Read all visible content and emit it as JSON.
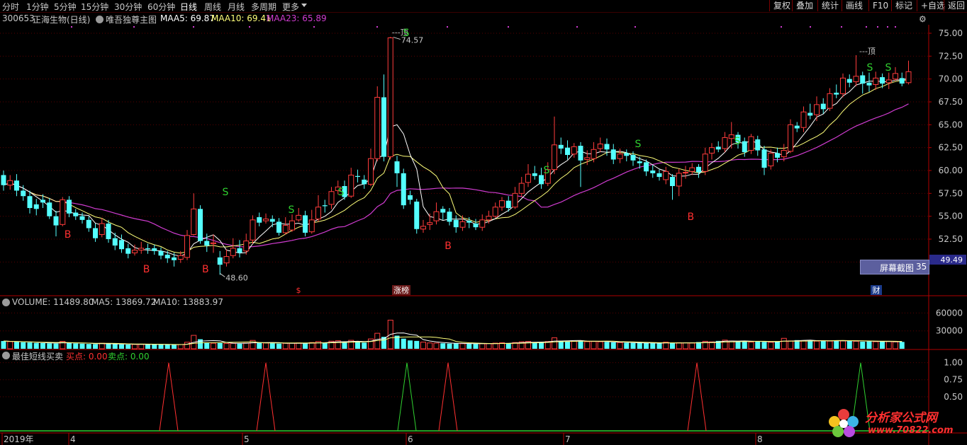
{
  "toolbar": {
    "periods": [
      "分时",
      "1分钟",
      "5分钟",
      "15分钟",
      "30分钟",
      "60分钟",
      "日线",
      "周线",
      "月线",
      "多周期",
      "更多"
    ],
    "active_period": "日线",
    "right_buttons": [
      "复权",
      "叠加",
      "统计",
      "画线",
      "F10",
      "标记",
      "+自选",
      "返回"
    ]
  },
  "stock": {
    "code": "300653",
    "name": "正海生物(日线)",
    "indicator": "唯吾独尊主图",
    "maa5_label": "MAA5: 69.87",
    "maa10_label": "MAA10: 69.41",
    "maa23_label": "MAA23: 65.89"
  },
  "colors": {
    "up": "#ff3c3c",
    "down": "#54ffff",
    "ma5": "#ffffff",
    "ma10": "#ffff7a",
    "ma23": "#d03cd0",
    "buy": "#ff3030",
    "sell": "#30d030",
    "axis": "#b00000",
    "grid": "#5a0000"
  },
  "chart_data": {
    "type": "candlestick",
    "title": "300653 正海生物(日线)",
    "y_ticks": [
      "75.00",
      "72.50",
      "70.00",
      "67.50",
      "65.00",
      "62.50",
      "60.00",
      "57.50",
      "55.00",
      "52.50"
    ],
    "ylim": [
      48.0,
      76.0
    ],
    "x_ticks": [
      "2019年",
      "4",
      "5",
      "6",
      "7",
      "8"
    ],
    "high_label": "74.57",
    "low_label": "48.60",
    "peak_label": "---顶",
    "peak_label_2": "---顶",
    "crosshair_price": "49.49",
    "candles": [
      [
        59.5,
        58.4,
        60.0,
        57.8
      ],
      [
        58.4,
        58.9,
        59.5,
        57.9
      ],
      [
        58.9,
        57.8,
        59.6,
        57.2
      ],
      [
        57.8,
        57.2,
        58.4,
        56.7
      ],
      [
        57.2,
        55.9,
        57.8,
        55.3
      ],
      [
        56.3,
        55.8,
        56.9,
        55.1
      ],
      [
        56.8,
        56.5,
        57.4,
        55.9
      ],
      [
        56.5,
        55.0,
        57.0,
        54.7
      ],
      [
        55.0,
        54.0,
        55.6,
        52.8
      ],
      [
        54.1,
        56.8,
        57.1,
        53.9
      ],
      [
        56.8,
        55.3,
        57.2,
        54.9
      ],
      [
        55.4,
        55.0,
        55.8,
        54.6
      ],
      [
        55.0,
        54.6,
        55.4,
        54.2
      ],
      [
        54.6,
        53.7,
        55.0,
        53.3
      ],
      [
        53.7,
        52.6,
        54.2,
        52.2
      ],
      [
        53.0,
        54.2,
        54.8,
        52.7
      ],
      [
        54.2,
        52.5,
        54.6,
        52.1
      ],
      [
        52.6,
        51.8,
        53.2,
        51.3
      ],
      [
        52.4,
        51.4,
        53.0,
        51.0
      ],
      [
        51.5,
        50.9,
        52.0,
        50.4
      ],
      [
        51.0,
        51.3,
        51.9,
        50.7
      ],
      [
        51.3,
        51.5,
        52.2,
        50.9
      ],
      [
        51.5,
        51.4,
        52.0,
        50.9
      ],
      [
        51.5,
        51.2,
        51.9,
        50.8
      ],
      [
        51.2,
        50.7,
        51.6,
        50.3
      ],
      [
        50.8,
        50.4,
        51.2,
        49.9
      ],
      [
        50.5,
        50.2,
        51.0,
        49.5
      ],
      [
        50.3,
        50.7,
        51.2,
        49.9
      ],
      [
        50.5,
        52.9,
        53.5,
        50.2
      ],
      [
        53.0,
        55.8,
        57.5,
        52.9
      ],
      [
        55.8,
        52.3,
        56.2,
        52.0
      ],
      [
        52.3,
        51.8,
        53.1,
        51.1
      ],
      [
        52.0,
        52.1,
        53.0,
        51.0
      ],
      [
        50.5,
        49.7,
        51.2,
        48.6
      ],
      [
        49.9,
        50.6,
        51.4,
        49.5
      ],
      [
        50.7,
        51.5,
        52.6,
        50.4
      ],
      [
        51.5,
        51.0,
        52.4,
        50.5
      ],
      [
        51.2,
        52.3,
        53.1,
        50.8
      ],
      [
        52.4,
        54.6,
        55.1,
        52.0
      ],
      [
        54.9,
        54.3,
        55.4,
        53.9
      ],
      [
        54.5,
        54.7,
        55.3,
        54.2
      ],
      [
        54.7,
        54.4,
        55.1,
        53.8
      ],
      [
        54.4,
        53.2,
        54.8,
        52.9
      ],
      [
        53.2,
        54.0,
        54.9,
        53.0
      ],
      [
        53.5,
        54.5,
        55.2,
        53.3
      ],
      [
        54.6,
        55.1,
        55.9,
        54.4
      ],
      [
        55.1,
        53.2,
        55.6,
        52.8
      ],
      [
        53.3,
        54.6,
        55.7,
        53.1
      ],
      [
        54.7,
        56.0,
        57.3,
        54.4
      ],
      [
        56.2,
        56.1,
        56.8,
        55.4
      ],
      [
        56.3,
        57.7,
        58.2,
        55.8
      ],
      [
        57.8,
        58.2,
        58.9,
        57.4
      ],
      [
        58.3,
        57.1,
        58.9,
        56.8
      ],
      [
        57.2,
        59.5,
        60.3,
        57.0
      ],
      [
        59.4,
        59.3,
        60.1,
        58.7
      ],
      [
        59.0,
        58.5,
        59.5,
        58.0
      ],
      [
        58.5,
        61.3,
        62.4,
        58.3
      ],
      [
        61.3,
        68.0,
        69.2,
        61.0
      ],
      [
        68.0,
        61.5,
        70.5,
        61.0
      ],
      [
        61.5,
        74.5,
        74.6,
        61.2
      ],
      [
        61.0,
        59.7,
        61.6,
        58.2
      ],
      [
        59.7,
        56.2,
        60.2,
        55.8
      ],
      [
        57.3,
        56.8,
        57.8,
        56.3
      ],
      [
        56.6,
        53.6,
        56.9,
        53.1
      ],
      [
        53.6,
        53.9,
        54.6,
        53.2
      ],
      [
        54.1,
        54.3,
        55.3,
        53.5
      ],
      [
        54.5,
        55.5,
        56.5,
        54.1
      ],
      [
        55.8,
        55.4,
        56.1,
        54.6
      ],
      [
        55.5,
        54.4,
        55.9,
        54.0
      ],
      [
        54.6,
        53.8,
        55.1,
        53.2
      ],
      [
        53.8,
        54.4,
        55.1,
        53.4
      ],
      [
        54.5,
        54.3,
        54.9,
        53.7
      ],
      [
        54.2,
        53.8,
        54.7,
        53.5
      ],
      [
        53.8,
        54.6,
        55.2,
        53.4
      ],
      [
        54.6,
        55.0,
        55.6,
        54.2
      ],
      [
        55.0,
        56.0,
        56.5,
        54.8
      ],
      [
        56.0,
        56.7,
        57.1,
        55.6
      ],
      [
        56.7,
        55.9,
        57.2,
        55.5
      ],
      [
        56.0,
        57.5,
        58.2,
        55.8
      ],
      [
        57.5,
        58.6,
        59.3,
        57.1
      ],
      [
        58.7,
        59.6,
        60.7,
        58.2
      ],
      [
        59.7,
        59.4,
        60.5,
        59.0
      ],
      [
        59.5,
        58.5,
        60.3,
        58.0
      ],
      [
        58.6,
        60.1,
        60.9,
        58.3
      ],
      [
        60.1,
        62.8,
        65.9,
        59.6
      ],
      [
        62.8,
        62.4,
        63.6,
        61.8
      ],
      [
        62.5,
        61.7,
        63.3,
        61.2
      ],
      [
        61.8,
        62.6,
        63.0,
        61.4
      ],
      [
        62.7,
        61.1,
        63.1,
        58.2
      ],
      [
        61.2,
        61.4,
        62.2,
        60.6
      ],
      [
        61.3,
        62.3,
        63.1,
        60.9
      ],
      [
        62.4,
        62.9,
        63.6,
        62.0
      ],
      [
        62.9,
        62.3,
        63.5,
        61.6
      ],
      [
        62.3,
        61.2,
        62.9,
        60.7
      ],
      [
        61.3,
        61.8,
        62.4,
        60.8
      ],
      [
        61.9,
        61.6,
        62.3,
        61.0
      ],
      [
        61.7,
        61.1,
        62.1,
        60.5
      ],
      [
        61.0,
        60.8,
        61.5,
        60.2
      ],
      [
        60.9,
        59.9,
        61.2,
        59.4
      ],
      [
        60.0,
        59.7,
        60.6,
        59.2
      ],
      [
        59.7,
        59.3,
        60.1,
        58.9
      ],
      [
        59.0,
        59.9,
        60.4,
        58.5
      ],
      [
        59.3,
        58.3,
        59.6,
        56.8
      ],
      [
        58.3,
        59.7,
        60.2,
        57.2
      ],
      [
        59.8,
        59.8,
        60.5,
        59.1
      ],
      [
        59.9,
        60.3,
        60.8,
        59.5
      ],
      [
        60.4,
        59.8,
        60.7,
        59.2
      ],
      [
        59.9,
        61.8,
        62.5,
        59.5
      ],
      [
        61.9,
        62.5,
        63.0,
        61.2
      ],
      [
        62.6,
        62.3,
        63.2,
        62.0
      ],
      [
        62.4,
        63.6,
        64.2,
        62.0
      ],
      [
        63.5,
        63.9,
        65.3,
        62.4
      ],
      [
        63.9,
        63.1,
        64.2,
        62.4
      ],
      [
        63.2,
        62.0,
        63.6,
        61.5
      ],
      [
        62.2,
        63.7,
        64.0,
        61.8
      ],
      [
        63.4,
        62.2,
        63.8,
        61.6
      ],
      [
        62.3,
        60.3,
        62.7,
        59.5
      ],
      [
        60.5,
        61.9,
        62.3,
        60.1
      ],
      [
        61.9,
        61.4,
        62.5,
        60.9
      ],
      [
        61.5,
        62.2,
        62.9,
        61.0
      ],
      [
        62.1,
        65.0,
        65.6,
        61.9
      ],
      [
        64.9,
        64.6,
        65.3,
        64.2
      ],
      [
        64.7,
        66.4,
        67.0,
        64.2
      ],
      [
        66.3,
        66.0,
        67.3,
        65.6
      ],
      [
        66.1,
        67.2,
        68.1,
        65.4
      ],
      [
        67.3,
        66.7,
        67.9,
        66.2
      ],
      [
        66.8,
        68.4,
        69.0,
        66.5
      ],
      [
        68.5,
        68.3,
        69.4,
        67.9
      ],
      [
        68.4,
        70.1,
        70.6,
        68.0
      ],
      [
        70.0,
        69.6,
        70.5,
        69.1
      ],
      [
        69.7,
        70.3,
        72.6,
        69.2
      ],
      [
        70.4,
        69.5,
        70.8,
        68.4
      ],
      [
        69.6,
        69.3,
        70.7,
        68.6
      ],
      [
        69.4,
        70.1,
        70.8,
        68.8
      ],
      [
        70.2,
        69.5,
        70.6,
        69.0
      ],
      [
        69.6,
        69.9,
        70.7,
        68.9
      ],
      [
        70.0,
        70.6,
        71.3,
        69.8
      ],
      [
        70.1,
        69.5,
        70.7,
        69.2
      ],
      [
        69.6,
        70.8,
        72.0,
        69.4
      ]
    ],
    "buy_points": [
      "B",
      "B",
      "B",
      "B",
      "B",
      "B"
    ],
    "sell_points": [
      "S",
      "S",
      "S",
      "S",
      "S",
      "S",
      "S",
      "S",
      "S"
    ],
    "markers_bottom": [
      "$",
      "涨榜",
      "财"
    ]
  },
  "volume_panel": {
    "title": "VOLUME: 11489.80",
    "ma5": "MA5: 13869.72",
    "ma10": "MA10: 13883.97",
    "y_ticks": [
      "60000",
      "30000"
    ],
    "volumes": [
      13000,
      12000,
      11500,
      11000,
      10500,
      9800,
      9500,
      9200,
      8800,
      12500,
      9600,
      8900,
      8500,
      8100,
      7900,
      9300,
      8300,
      7700,
      7400,
      7100,
      7300,
      7600,
      7500,
      7200,
      6900,
      6800,
      6700,
      7200,
      11000,
      22500,
      16000,
      9800,
      9300,
      9700,
      8800,
      9100,
      8600,
      9500,
      14000,
      10200,
      9800,
      9300,
      8700,
      9100,
      9400,
      9800,
      8800,
      10500,
      12200,
      10000,
      12800,
      13500,
      10800,
      14200,
      11500,
      10400,
      16500,
      26000,
      20000,
      48000,
      22000,
      17000,
      14000,
      13200,
      11200,
      9800,
      9500,
      9200,
      8700,
      8900,
      8500,
      8400,
      8200,
      8600,
      8800,
      9500,
      10200,
      9300,
      10500,
      11800,
      12400,
      11200,
      10400,
      12200,
      18500,
      13200,
      12100,
      12600,
      13800,
      11900,
      12200,
      11800,
      11500,
      10800,
      10400,
      10100,
      9800,
      9500,
      9700,
      9300,
      9100,
      11200,
      9400,
      10200,
      10100,
      9600,
      11300,
      12600,
      11600,
      13200,
      14500,
      13100,
      12100,
      12700,
      11300,
      12900,
      11500,
      10900,
      11600,
      17500,
      13200,
      14500,
      13600,
      14100,
      12800,
      13400,
      12900,
      14300,
      13200,
      14100,
      12600,
      11900,
      12300,
      11800,
      12100,
      12300,
      11500,
      11489.8
    ],
    "ylim": [
      0,
      70000
    ]
  },
  "indicator_panel": {
    "title": "最佳短线买卖",
    "buy_label": "买点: 0.00",
    "sell_label": "卖点: 0.00",
    "y_ticks": [
      "1.00",
      "0.75",
      "0.50"
    ],
    "ylim": [
      0,
      1.1
    ]
  },
  "screenshot_button": {
    "label": "屏幕截图",
    "value": "35"
  },
  "watermark": {
    "brand": "分析家公式网",
    "url": "www.70822.com"
  }
}
